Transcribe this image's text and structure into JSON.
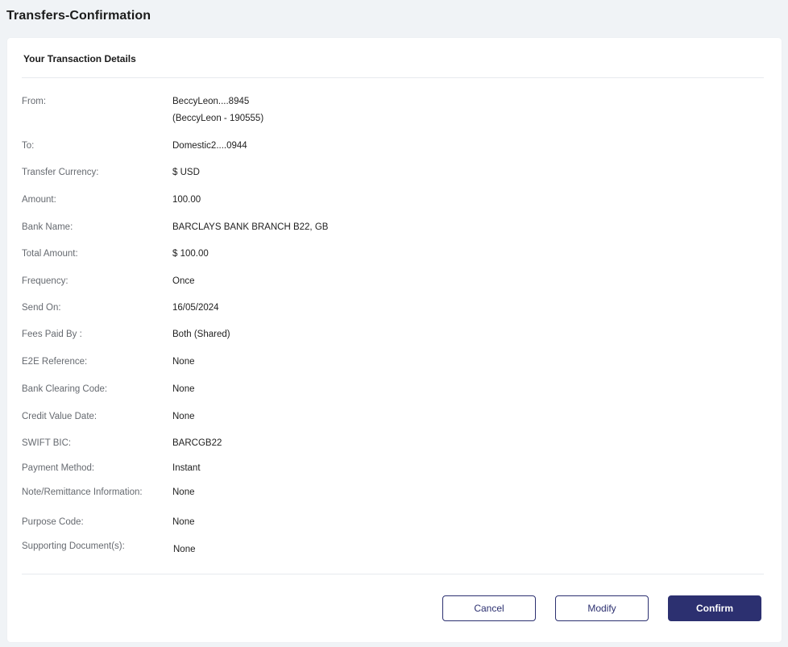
{
  "page": {
    "title": "Transfers-Confirmation"
  },
  "card": {
    "header": "Your Transaction Details"
  },
  "details": {
    "from": {
      "label": "From:",
      "value_line1": "BeccyLeon....8945",
      "value_line2": "(BeccyLeon - 190555)"
    },
    "to": {
      "label": "To:",
      "value": "Domestic2....0944"
    },
    "transfer_currency": {
      "label": "Transfer Currency:",
      "value": "$ USD"
    },
    "amount": {
      "label": "Amount:",
      "value": "100.00"
    },
    "bank_name": {
      "label": "Bank Name:",
      "value": "BARCLAYS BANK BRANCH B22, GB"
    },
    "total_amount": {
      "label": "Total Amount:",
      "value": "$ 100.00"
    },
    "frequency": {
      "label": "Frequency:",
      "value": "Once"
    },
    "send_on": {
      "label": "Send On:",
      "value": "16/05/2024"
    },
    "fees_paid_by": {
      "label": "Fees Paid By :",
      "value": "Both (Shared)"
    },
    "e2e_reference": {
      "label": "E2E Reference:",
      "value": "None"
    },
    "bank_clearing_code": {
      "label": "Bank Clearing Code:",
      "value": "None"
    },
    "credit_value_date": {
      "label": "Credit Value Date:",
      "value": "None"
    },
    "swift_bic": {
      "label": "SWIFT BIC:",
      "value": "BARCGB22"
    },
    "payment_method": {
      "label": "Payment Method:",
      "value": "Instant"
    },
    "note_remittance": {
      "label": "Note/Remittance Information:",
      "value": "None"
    },
    "purpose_code": {
      "label": "Purpose Code:",
      "value": "None"
    },
    "supporting_documents": {
      "label": "Supporting Document(s):",
      "value": "None"
    }
  },
  "actions": {
    "cancel": "Cancel",
    "modify": "Modify",
    "confirm": "Confirm"
  },
  "colors": {
    "primary": "#2c3070",
    "background": "#f0f3f6",
    "label": "#666a70"
  }
}
